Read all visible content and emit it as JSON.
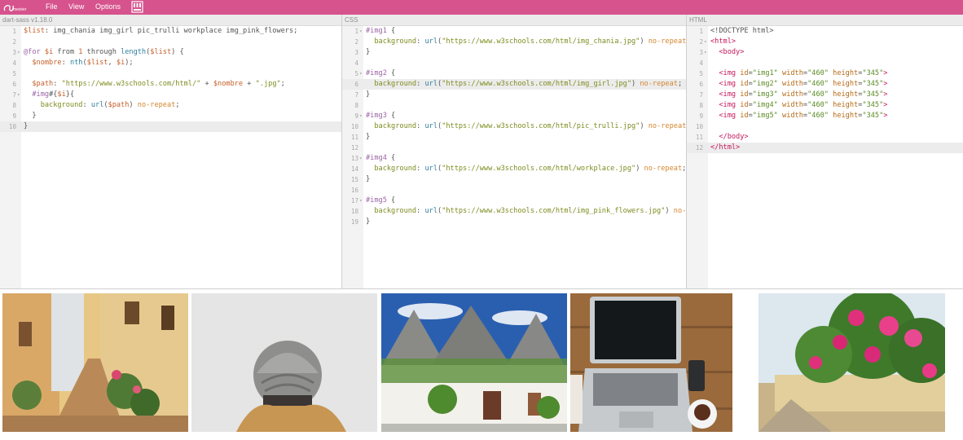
{
  "app": {
    "logo_text": "Sassmeister",
    "menu": [
      "File",
      "View",
      "Options"
    ],
    "gist_icon": "gist-icon"
  },
  "panes": {
    "sass": {
      "header": "dart-sass v1.18.0",
      "active_line": 10,
      "lines": [
        {
          "n": "1",
          "fold": false,
          "html": "<span class=\"var\">$list</span>: img_chania img_girl pic_trulli workplace img_pink_flowers;"
        },
        {
          "n": "2",
          "fold": false,
          "html": ""
        },
        {
          "n": "3",
          "fold": true,
          "html": "<span class=\"kw\">@for</span> <span class=\"var\">$i</span> from <span class=\"num\">1</span> through <span class=\"fn\">length</span>(<span class=\"var\">$list</span>) {"
        },
        {
          "n": "4",
          "fold": false,
          "html": "  <span class=\"var\">$nombre</span>: <span class=\"fn\">nth</span>(<span class=\"var\">$list</span>, <span class=\"var\">$i</span>);"
        },
        {
          "n": "5",
          "fold": false,
          "html": ""
        },
        {
          "n": "6",
          "fold": false,
          "html": "  <span class=\"var\">$path</span>: <span class=\"str\">\"https://www.w3schools.com/html/\"</span> + <span class=\"var\">$nombre</span> + <span class=\"str\">\".jpg\"</span>;"
        },
        {
          "n": "7",
          "fold": true,
          "html": "  <span class=\"sel\">#img</span>#{<span class=\"var\">$i</span>}{"
        },
        {
          "n": "8",
          "fold": false,
          "html": "    <span class=\"prop\">background</span>: <span class=\"fn\">url</span>(<span class=\"var\">$path</span>) <span class=\"kw2\">no-repeat</span>;"
        },
        {
          "n": "9",
          "fold": false,
          "html": "  }"
        },
        {
          "n": "10",
          "fold": false,
          "html": "}"
        }
      ]
    },
    "css": {
      "header": "CSS",
      "active_line": 6,
      "lines": [
        {
          "n": "1",
          "fold": true,
          "html": "<span class=\"sel\">#img1</span> {"
        },
        {
          "n": "2",
          "fold": false,
          "html": "  <span class=\"prop\">background</span>: <span class=\"val\">url</span>(<span class=\"str\">\"https://www.w3schools.com/html/img_chania.jpg\"</span>) <span class=\"kw2\">no-repeat</span>;"
        },
        {
          "n": "3",
          "fold": false,
          "html": "}"
        },
        {
          "n": "4",
          "fold": false,
          "html": ""
        },
        {
          "n": "5",
          "fold": true,
          "html": "<span class=\"sel\">#img2</span> {"
        },
        {
          "n": "6",
          "fold": false,
          "html": "  <span class=\"prop\">background</span>: <span class=\"val\">url</span>(<span class=\"str\">\"https://www.w3schools.com/html/img_girl.jpg\"</span>) <span class=\"kw2\">no-repeat</span>;"
        },
        {
          "n": "7",
          "fold": false,
          "html": "}"
        },
        {
          "n": "8",
          "fold": false,
          "html": ""
        },
        {
          "n": "9",
          "fold": true,
          "html": "<span class=\"sel\">#img3</span> {"
        },
        {
          "n": "10",
          "fold": false,
          "html": "  <span class=\"prop\">background</span>: <span class=\"val\">url</span>(<span class=\"str\">\"https://www.w3schools.com/html/pic_trulli.jpg\"</span>) <span class=\"kw2\">no-repeat</span>;"
        },
        {
          "n": "11",
          "fold": false,
          "html": "}"
        },
        {
          "n": "12",
          "fold": false,
          "html": ""
        },
        {
          "n": "13",
          "fold": true,
          "html": "<span class=\"sel\">#img4</span> {"
        },
        {
          "n": "14",
          "fold": false,
          "html": "  <span class=\"prop\">background</span>: <span class=\"val\">url</span>(<span class=\"str\">\"https://www.w3schools.com/html/workplace.jpg\"</span>) <span class=\"kw2\">no-repeat</span>;"
        },
        {
          "n": "15",
          "fold": false,
          "html": "}"
        },
        {
          "n": "16",
          "fold": false,
          "html": ""
        },
        {
          "n": "17",
          "fold": true,
          "html": "<span class=\"sel\">#img5</span> {"
        },
        {
          "n": "18",
          "fold": false,
          "html": "  <span class=\"prop\">background</span>: <span class=\"val\">url</span>(<span class=\"str\">\"https://www.w3schools.com/html/img_pink_flowers.jpg\"</span>) <span class=\"kw2\">no-repeat</span>;"
        },
        {
          "n": "19",
          "fold": false,
          "html": "}"
        }
      ]
    },
    "html": {
      "header": "HTML",
      "active_line": 12,
      "lines": [
        {
          "n": "1",
          "fold": false,
          "html": "&lt;!DOCTYPE html&gt;"
        },
        {
          "n": "2",
          "fold": true,
          "html": "<span class=\"tag\">&lt;html&gt;</span>"
        },
        {
          "n": "3",
          "fold": true,
          "html": "  <span class=\"tag\">&lt;body&gt;</span>"
        },
        {
          "n": "4",
          "fold": false,
          "html": ""
        },
        {
          "n": "5",
          "fold": false,
          "html": "  <span class=\"tag\">&lt;img</span> <span class=\"attr\">id</span>=<span class=\"aval\">\"img1\"</span> <span class=\"attr\">width</span>=<span class=\"aval\">\"460\"</span> <span class=\"attr\">height</span>=<span class=\"aval\">\"345\"</span><span class=\"tag\">&gt;</span>"
        },
        {
          "n": "6",
          "fold": false,
          "html": "  <span class=\"tag\">&lt;img</span> <span class=\"attr\">id</span>=<span class=\"aval\">\"img2\"</span> <span class=\"attr\">width</span>=<span class=\"aval\">\"460\"</span> <span class=\"attr\">height</span>=<span class=\"aval\">\"345\"</span><span class=\"tag\">&gt;</span>"
        },
        {
          "n": "7",
          "fold": false,
          "html": "  <span class=\"tag\">&lt;img</span> <span class=\"attr\">id</span>=<span class=\"aval\">\"img3\"</span> <span class=\"attr\">width</span>=<span class=\"aval\">\"460\"</span> <span class=\"attr\">height</span>=<span class=\"aval\">\"345\"</span><span class=\"tag\">&gt;</span>"
        },
        {
          "n": "8",
          "fold": false,
          "html": "  <span class=\"tag\">&lt;img</span> <span class=\"attr\">id</span>=<span class=\"aval\">\"img4\"</span> <span class=\"attr\">width</span>=<span class=\"aval\">\"460\"</span> <span class=\"attr\">height</span>=<span class=\"aval\">\"345\"</span><span class=\"tag\">&gt;</span>"
        },
        {
          "n": "9",
          "fold": false,
          "html": "  <span class=\"tag\">&lt;img</span> <span class=\"attr\">id</span>=<span class=\"aval\">\"img5\"</span> <span class=\"attr\">width</span>=<span class=\"aval\">\"460\"</span> <span class=\"attr\">height</span>=<span class=\"aval\">\"345\"</span><span class=\"tag\">&gt;</span>"
        },
        {
          "n": "10",
          "fold": false,
          "html": ""
        },
        {
          "n": "11",
          "fold": false,
          "html": "  <span class=\"tag\">&lt;/body&gt;</span>"
        },
        {
          "n": "12",
          "fold": false,
          "html": "<span class=\"tag\">&lt;/html&gt;</span>"
        }
      ]
    }
  },
  "preview": {
    "images": [
      "img1",
      "img2",
      "img3",
      "img4",
      "img5"
    ]
  },
  "colors": {
    "topbar": "#d6538d"
  }
}
